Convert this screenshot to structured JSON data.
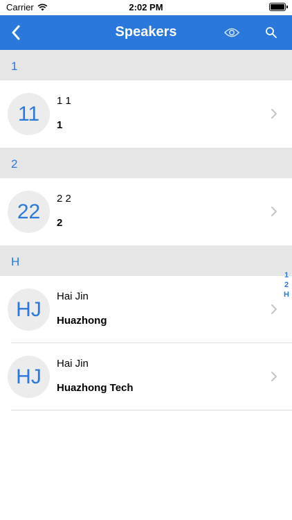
{
  "status_bar": {
    "carrier": "Carrier",
    "time": "2:02 PM"
  },
  "nav": {
    "title": "Speakers",
    "back_icon": "chevron-left-icon",
    "eye_icon": "eye-icon",
    "search_icon": "search-icon"
  },
  "sections": [
    {
      "header": "1",
      "rows": [
        {
          "initials": "11",
          "name": "1 1",
          "org": "1"
        }
      ]
    },
    {
      "header": "2",
      "rows": [
        {
          "initials": "22",
          "name": "2 2",
          "org": "2"
        }
      ]
    },
    {
      "header": "H",
      "rows": [
        {
          "initials": "HJ",
          "name": "Hai Jin",
          "org": "Huazhong"
        },
        {
          "initials": "HJ",
          "name": "Hai Jin",
          "org": "Huazhong Tech"
        }
      ]
    }
  ],
  "index": [
    "1",
    "2",
    "H"
  ],
  "colors": {
    "accent": "#2a78dc",
    "section_bg": "#e6e6e6",
    "avatar_bg": "#ececec"
  }
}
